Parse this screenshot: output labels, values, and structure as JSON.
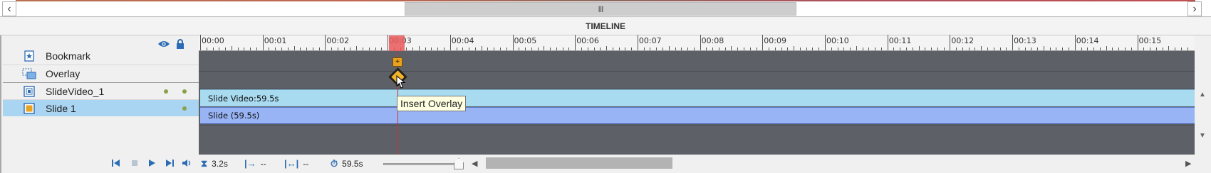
{
  "top_scrollbar": {
    "left_arrow": "‹",
    "thumb_grip": "III",
    "right_arrow": "›"
  },
  "panel_title": "TIMELINE",
  "header_icons": [
    "eye-icon",
    "lock-icon"
  ],
  "ruler_labels": [
    "00:00",
    "00:01",
    "00:02",
    "00:03",
    "00:04",
    "00:05",
    "00:06",
    "00:07",
    "00:08",
    "00:09",
    "00:10",
    "00:11",
    "00:12",
    "00:13",
    "00:14",
    "00:15"
  ],
  "layers": [
    {
      "name": "Bookmark",
      "icon": "bookmark-icon"
    },
    {
      "name": "Overlay",
      "icon": "overlay-icon"
    },
    {
      "name": "SlideVideo_1",
      "icon": "video-icon"
    },
    {
      "name": "Slide 1",
      "icon": "slide-icon"
    }
  ],
  "tracks": {
    "video_bar": "Slide Video:59.5s",
    "slide_bar": "Slide (59.5s)",
    "bookmark_marker": "+"
  },
  "tooltip": "Insert Overlay",
  "transport": [
    "rewind-icon",
    "stop-icon",
    "play-icon",
    "next-icon",
    "volume-icon"
  ],
  "info_bar": {
    "current_time": "3.2s",
    "start": "--",
    "duration": "--",
    "total": "59.5s"
  },
  "colors": {
    "track_bg": "#5e6068",
    "video_bar": "#a8daf0",
    "slide_bar": "#98b4f4",
    "playhead": "#d03030",
    "accent": "#2c6cb4"
  }
}
